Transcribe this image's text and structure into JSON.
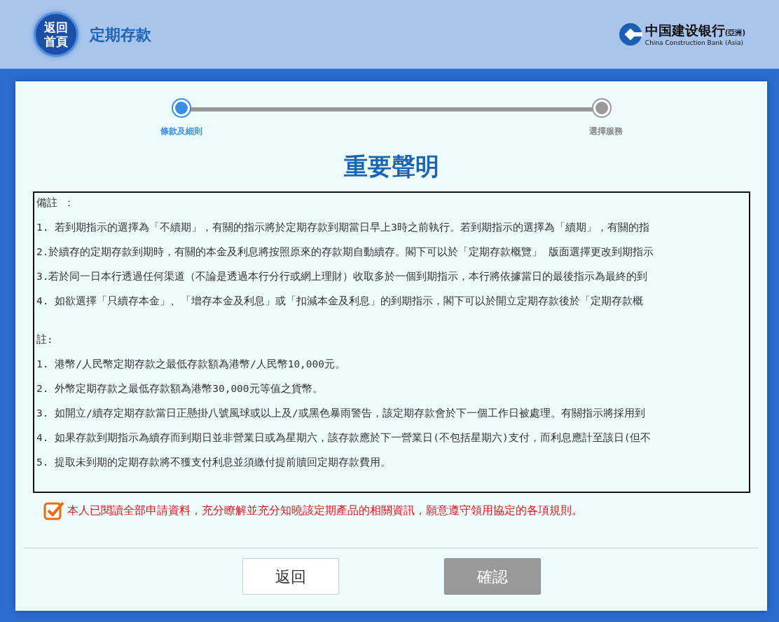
{
  "header": {
    "home_button": "返回首頁",
    "title": "定期存款",
    "logo": {
      "name": "中国建设银行",
      "region": "(亞洲)",
      "english": "China Construction Bank (Asia)"
    }
  },
  "steps": [
    {
      "label": "條款及細則",
      "selected": true
    },
    {
      "label": "選擇服務",
      "selected": false
    }
  ],
  "heading": "重要聲明",
  "sections": [
    {
      "title": "備註 ：",
      "items": [
        "1. 若到期指示的選擇為「不續期」，有關的指示將於定期存款到期當日早上3時之前執行。若到期指示的選擇為「續期」，有關的指",
        "2.於續存的定期存款到期時，有關的本金及利息將按照原來的存款期自動續存。閣下可以於「定期存款概覽」 版面選擇更改到期指示",
        "3.若於同一日本行透過任何渠道（不論是透過本行分行或網上理財）收取多於一個到期指示，本行將依據當日的最後指示為最終的到",
        "4.  如欲選擇「只續存本金」、「增存本金及利息」或「扣減本金及利息」的到期指示，閣下可以於開立定期存款後於「定期存款概"
      ]
    },
    {
      "title": "註:",
      "items": [
        "1. 港幣/人民幣定期存款之最低存款額為港幣/人民幣10,000元。",
        "2. 外幣定期存款之最低存款額為港幣30,000元等值之貨幣。",
        "3. 如開立/續存定期存款當日正懸掛八號風球或以上及/或黑色暴雨警告，該定期存款會於下一個工作日被處理。有關指示將採用到",
        "4. 如果存款到期指示為續存而到期日並非營業日或為星期六，該存款應於下一營業日(不包括星期六)支付，而利息應計至該日(但不",
        "5. 提取未到期的定期存款將不獲支付利息並須繳付提前贖回定期存款費用。"
      ]
    }
  ],
  "agreement": {
    "checked": true,
    "text": "本人已閱讀全部申請資料，充分瞭解並充分知曉該定期產品的相關資訊，願意遵守領用協定的各項規則。"
  },
  "buttons": [
    {
      "label": "返回",
      "disabled": false
    },
    {
      "label": "確認",
      "disabled": true
    }
  ]
}
